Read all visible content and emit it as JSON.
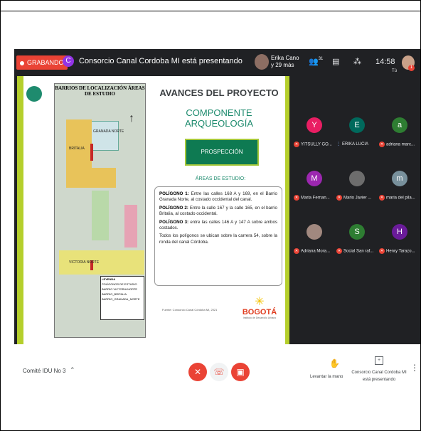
{
  "topbar": {
    "recording_label": "GRABANDO",
    "presenter_initial": "C",
    "presenting_text": "Consorcio Canal Cordoba MI está presentando",
    "pinned_name_line1": "Erika Cano",
    "pinned_name_line2": "y 29 más",
    "people_count": "31",
    "clock": "14:58",
    "you_label": "Tú",
    "badge": "1"
  },
  "slide": {
    "map_title": "BARRIOS DE LOCALIZACIÓN ÁREAS DE ESTUDIO",
    "map_labels": [
      "GRANADA NORTE",
      "BRITALIA",
      "VICTORIA NORTE",
      "LEYENDA"
    ],
    "legend_items": [
      "POLÍGONOS DE ESTUDIO",
      "BARRIO VICTORIA NORTE",
      "BARRIO_BRITALIA",
      "BARRIO_GRANADA_NORTE"
    ],
    "title": "AVANCES DEL PROYECTO",
    "subtitle": "COMPONENTE ARQUEOLOGÍA",
    "section_button": "PROSPECCIÓN ARQUEOLÓGICA",
    "areas_heading": "ÁREAS DE ESTUDIO:",
    "paragraphs": [
      {
        "bold": "POLÍGONO 1:",
        "text": " Entre las calles 168 A y 169, en el Barrio Granada Norte, al costado occidental del canal."
      },
      {
        "bold": "POLÍGONO 2:",
        "text": " Entre la calle 167 y la calle 165, en el barrio Britalia, al costado occidental."
      },
      {
        "bold": "POLÍGONO 3:",
        "text": " entre las calles 146 A y 147 A sobre ambos costados."
      },
      {
        "bold": "",
        "text": "Todos los polígonos se ubican sobre la carrera 54, sobre la ronda del canal Córdoba."
      }
    ],
    "source": "Fuente: Consorcio Canal Córdoba MI, 2021",
    "logo_text": "BOGOTÁ",
    "logo_sub": "Instituto de Desarrollo Urbano"
  },
  "participants": [
    {
      "initial": "Y",
      "name": "YITSULLY GO...",
      "color": "#e91e63",
      "muted": true
    },
    {
      "initial": "E",
      "name": "ERIKA LUCIA",
      "color": "#00695c",
      "muted": false
    },
    {
      "initial": "a",
      "name": "adriana marc...",
      "color": "#2e7d32",
      "muted": true
    },
    {
      "initial": "M",
      "name": "Maria Fernan...",
      "color": "#9c27b0",
      "muted": true
    },
    {
      "initial": "",
      "name": "Mario Javier ...",
      "color": "#6d6d6d",
      "muted": true
    },
    {
      "initial": "m",
      "name": "maria del pila...",
      "color": "#78909c",
      "muted": true
    },
    {
      "initial": "",
      "name": "Adriana Mora...",
      "color": "#a1887f",
      "muted": true
    },
    {
      "initial": "S",
      "name": "Social San raf...",
      "color": "#2e7d32",
      "muted": true
    },
    {
      "initial": "H",
      "name": "Henry Tarazo...",
      "color": "#6a1b9a",
      "muted": true
    }
  ],
  "bottombar": {
    "meeting_name": "Comité IDU No 3",
    "raise_hand": "Levantar la mano",
    "presenter_line1": "Consorcio Canal Cordoba MI",
    "presenter_line2": "está presentando"
  }
}
